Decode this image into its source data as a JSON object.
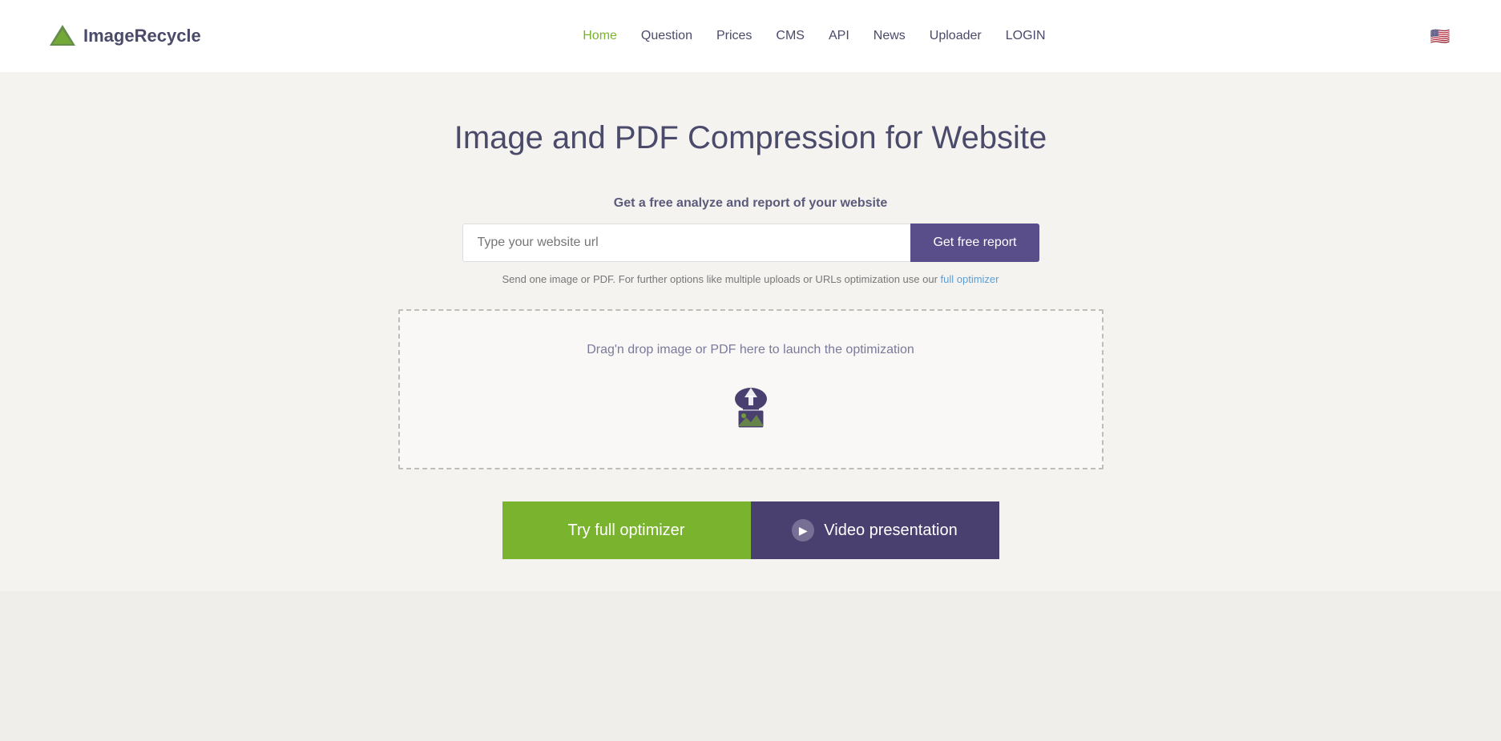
{
  "header": {
    "logo_image": "▼",
    "logo_text_normal": "Image",
    "logo_text_bold": "Recycle",
    "nav_items": [
      {
        "label": "Home",
        "active": true
      },
      {
        "label": "Question",
        "active": false
      },
      {
        "label": "Prices",
        "active": false
      },
      {
        "label": "CMS",
        "active": false
      },
      {
        "label": "API",
        "active": false
      },
      {
        "label": "News",
        "active": false
      },
      {
        "label": "Uploader",
        "active": false
      },
      {
        "label": "LOGIN",
        "active": false
      }
    ],
    "lang_flag": "🇺🇸"
  },
  "main": {
    "page_title": "Image and PDF Compression for Website",
    "analyze_subtitle": "Get a free analyze and report of your website",
    "url_input_placeholder": "Type your website url",
    "get_report_btn": "Get free report",
    "note_text_before": "Send one image or PDF. For further options like multiple uploads or URLs optimization use our ",
    "note_link_text": "full optimizer",
    "drop_zone_text": "Drag'n drop image or PDF here to launch the optimization",
    "try_optimizer_btn": "Try full optimizer",
    "video_btn": "Video presentation"
  }
}
